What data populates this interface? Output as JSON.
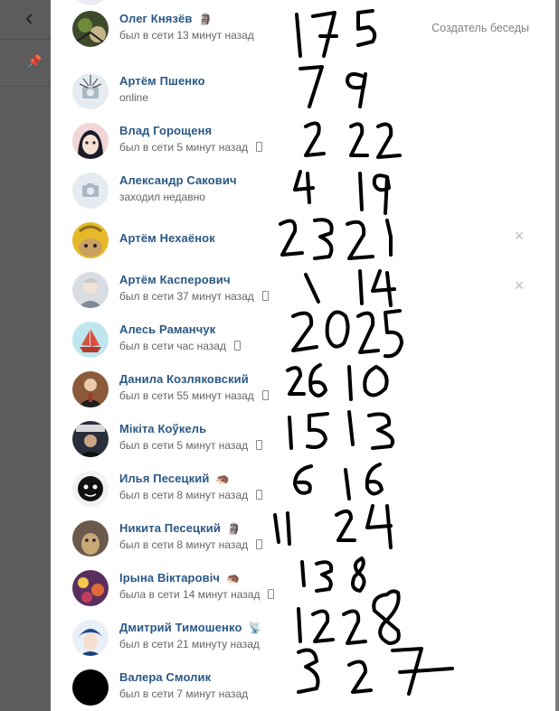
{
  "members": [
    {
      "name": "Олег Князёв",
      "emoji": "🗿",
      "status": "был в сети 13 минут назад",
      "phone": false,
      "role": "Создатель беседы",
      "removable": false,
      "avatar": "avatar-photo-art",
      "numbers": "17 5"
    },
    {
      "name": "Артём Пшенко",
      "emoji": "",
      "status": "online",
      "phone": false,
      "role": "",
      "removable": false,
      "avatar": "camera-placeholder-spider",
      "numbers": "7 9"
    },
    {
      "name": "Влад Горощеня",
      "emoji": "",
      "status": "был в сети 5 минут назад",
      "phone": true,
      "role": "",
      "removable": false,
      "avatar": "avatar-anime",
      "numbers": "2 22"
    },
    {
      "name": "Александр Сакович",
      "emoji": "",
      "status": "заходил недавно",
      "phone": false,
      "role": "",
      "removable": false,
      "avatar": "camera-placeholder",
      "numbers": "4 19"
    },
    {
      "name": "Артём Нехаёнок",
      "emoji": "",
      "status": "",
      "phone": false,
      "role": "",
      "removable": true,
      "avatar": "avatar-cat-yellow",
      "numbers": "23 21"
    },
    {
      "name": "Артём Касперович",
      "emoji": "",
      "status": "был в сети 37 минут назад",
      "phone": true,
      "role": "",
      "removable": true,
      "avatar": "avatar-person-grey",
      "numbers": "1 14"
    },
    {
      "name": "Алесь Раманчук",
      "emoji": "",
      "status": "был в сети час назад",
      "phone": true,
      "role": "",
      "removable": false,
      "avatar": "avatar-ship",
      "numbers": "20 25"
    },
    {
      "name": "Данила Козляковский",
      "emoji": "",
      "status": "был в сети 55 минут назад",
      "phone": true,
      "role": "",
      "removable": false,
      "avatar": "avatar-person-suit",
      "numbers": "26 10"
    },
    {
      "name": "Мікіта Коўкель",
      "emoji": "",
      "status": "был в сети 5 минут назад",
      "phone": true,
      "role": "",
      "removable": false,
      "avatar": "avatar-person-dark",
      "numbers": "15 13"
    },
    {
      "name": "Илья Песецкий",
      "emoji": "🦔",
      "status": "был в сети 8 минут назад",
      "phone": true,
      "role": "",
      "removable": false,
      "avatar": "avatar-face-dark",
      "numbers": "6 16"
    },
    {
      "name": "Никита Песецкий",
      "emoji": "🗿",
      "status": "был в сети 8 минут назад",
      "phone": true,
      "role": "",
      "removable": false,
      "avatar": "avatar-dog",
      "numbers": "11 24"
    },
    {
      "name": "Ірына Віктаровіч",
      "emoji": "🦔",
      "status": "была в сети 14 минут назад",
      "phone": true,
      "role": "",
      "removable": false,
      "avatar": "avatar-flowers",
      "numbers": "13 8"
    },
    {
      "name": "Дмитрий Тимошенко",
      "emoji": "📡",
      "status": "был в сети 21 минуту назад",
      "phone": false,
      "role": "",
      "removable": false,
      "avatar": "avatar-anime-blue",
      "numbers": "12 28"
    },
    {
      "name": "Валера Смолик",
      "emoji": "",
      "status": "был в сети 7 минут назад",
      "phone": false,
      "role": "",
      "removable": false,
      "avatar": "avatar-black",
      "numbers": "3 27"
    }
  ],
  "colors": {
    "name": "#2a5885",
    "status": "#656565",
    "role": "#828282",
    "ink": "#000000"
  }
}
